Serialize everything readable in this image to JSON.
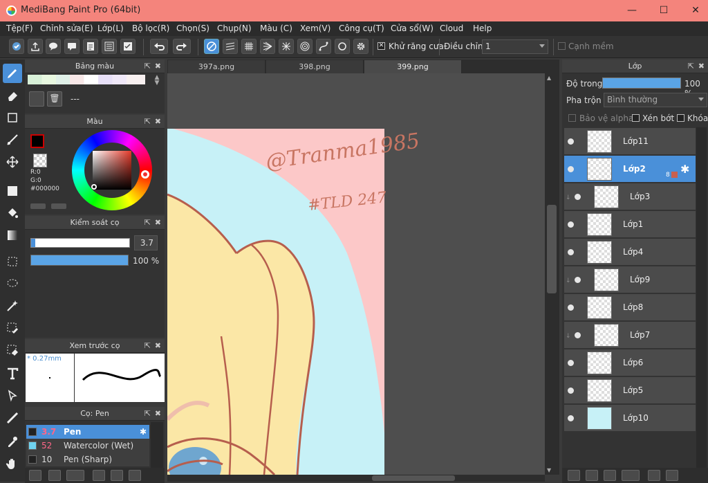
{
  "window": {
    "title": "MediBang Paint Pro (64bit)",
    "minimize": "—",
    "maximize": "☐",
    "close": "✕"
  },
  "menu": [
    "Tệp(F)",
    "Chỉnh sửa(E)",
    "Lớp(L)",
    "Bộ lọc(R)",
    "Chọn(S)",
    "Chụp(N)",
    "Màu (C)",
    "Xem(V)",
    "Công cụ(T)",
    "Cửa sổ(W)",
    "Cloud",
    "Help"
  ],
  "toolbar": {
    "antialias_label": "Khử răng cưa",
    "antialias_checked": "✕",
    "correction_label": "Điều chỉnh",
    "correction_value": "1",
    "soft_edge_label": "Cạnh mềm"
  },
  "palette": {
    "title": "Bảng màu",
    "current": "---"
  },
  "color": {
    "title": "Màu",
    "r": "R:0",
    "g": "G:0",
    "b": "B:0",
    "hex": "#000000"
  },
  "brush_control": {
    "title": "Kiểm soát cọ",
    "size": "3.7",
    "opacity": "100 %",
    "opacity_fraction": 1.0
  },
  "brush_preview": {
    "title": "Xem trước cọ",
    "size": "* 0.27mm"
  },
  "brushes": {
    "title": "Cọ: Pen",
    "items": [
      {
        "size": "3.7",
        "name": "Pen",
        "color": "#222222"
      },
      {
        "size": "52",
        "name": "Watercolor (Wet)",
        "color": "#6fd3f0"
      },
      {
        "size": "10",
        "name": "Pen (Sharp)",
        "color": "#222222"
      }
    ]
  },
  "tabs": [
    "397a.png",
    "398.png",
    "399.png"
  ],
  "canvas": {
    "signature": "@Tranma1985",
    "hashtag": "#TLD 247"
  },
  "layers": {
    "title": "Lớp",
    "opacity_label": "Độ trong",
    "opacity_value": "100 %",
    "opacity_fraction": 1.0,
    "blend_label": "Pha trộn",
    "blend_value": "Bình thường",
    "protect_alpha": "Bảo vệ alpha",
    "clip": "Xén bớt",
    "lock": "Khóa",
    "selected_badge": "8",
    "items": [
      {
        "name": "Lớp11",
        "clip": false
      },
      {
        "name": "Lớp2",
        "clip": false
      },
      {
        "name": "Lớp3",
        "clip": true
      },
      {
        "name": "Lớp1",
        "clip": false
      },
      {
        "name": "Lớp4",
        "clip": false
      },
      {
        "name": "Lớp9",
        "clip": true
      },
      {
        "name": "Lớp8",
        "clip": false
      },
      {
        "name": "Lớp7",
        "clip": true
      },
      {
        "name": "Lớp6",
        "clip": false
      },
      {
        "name": "Lớp5",
        "clip": false
      },
      {
        "name": "Lớp10",
        "clip": false
      }
    ]
  }
}
